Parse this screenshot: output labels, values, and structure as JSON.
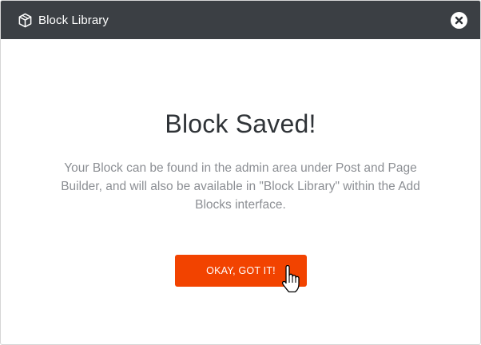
{
  "dialog": {
    "title": "Block Library",
    "icon": "cube-icon",
    "close_icon": "close-icon"
  },
  "content": {
    "heading": "Block Saved!",
    "message": "Your Block can be found in the admin area under Post and Page Builder, and will also be available in \"Block Library\" within the Add Blocks interface.",
    "confirm_label": "OKAY, GOT IT!"
  },
  "colors": {
    "titlebar": "#3b3f44",
    "accent": "#f24300",
    "heading": "#2f3337",
    "body_text": "#8c8f94"
  },
  "cursor": "hand-pointer-icon"
}
